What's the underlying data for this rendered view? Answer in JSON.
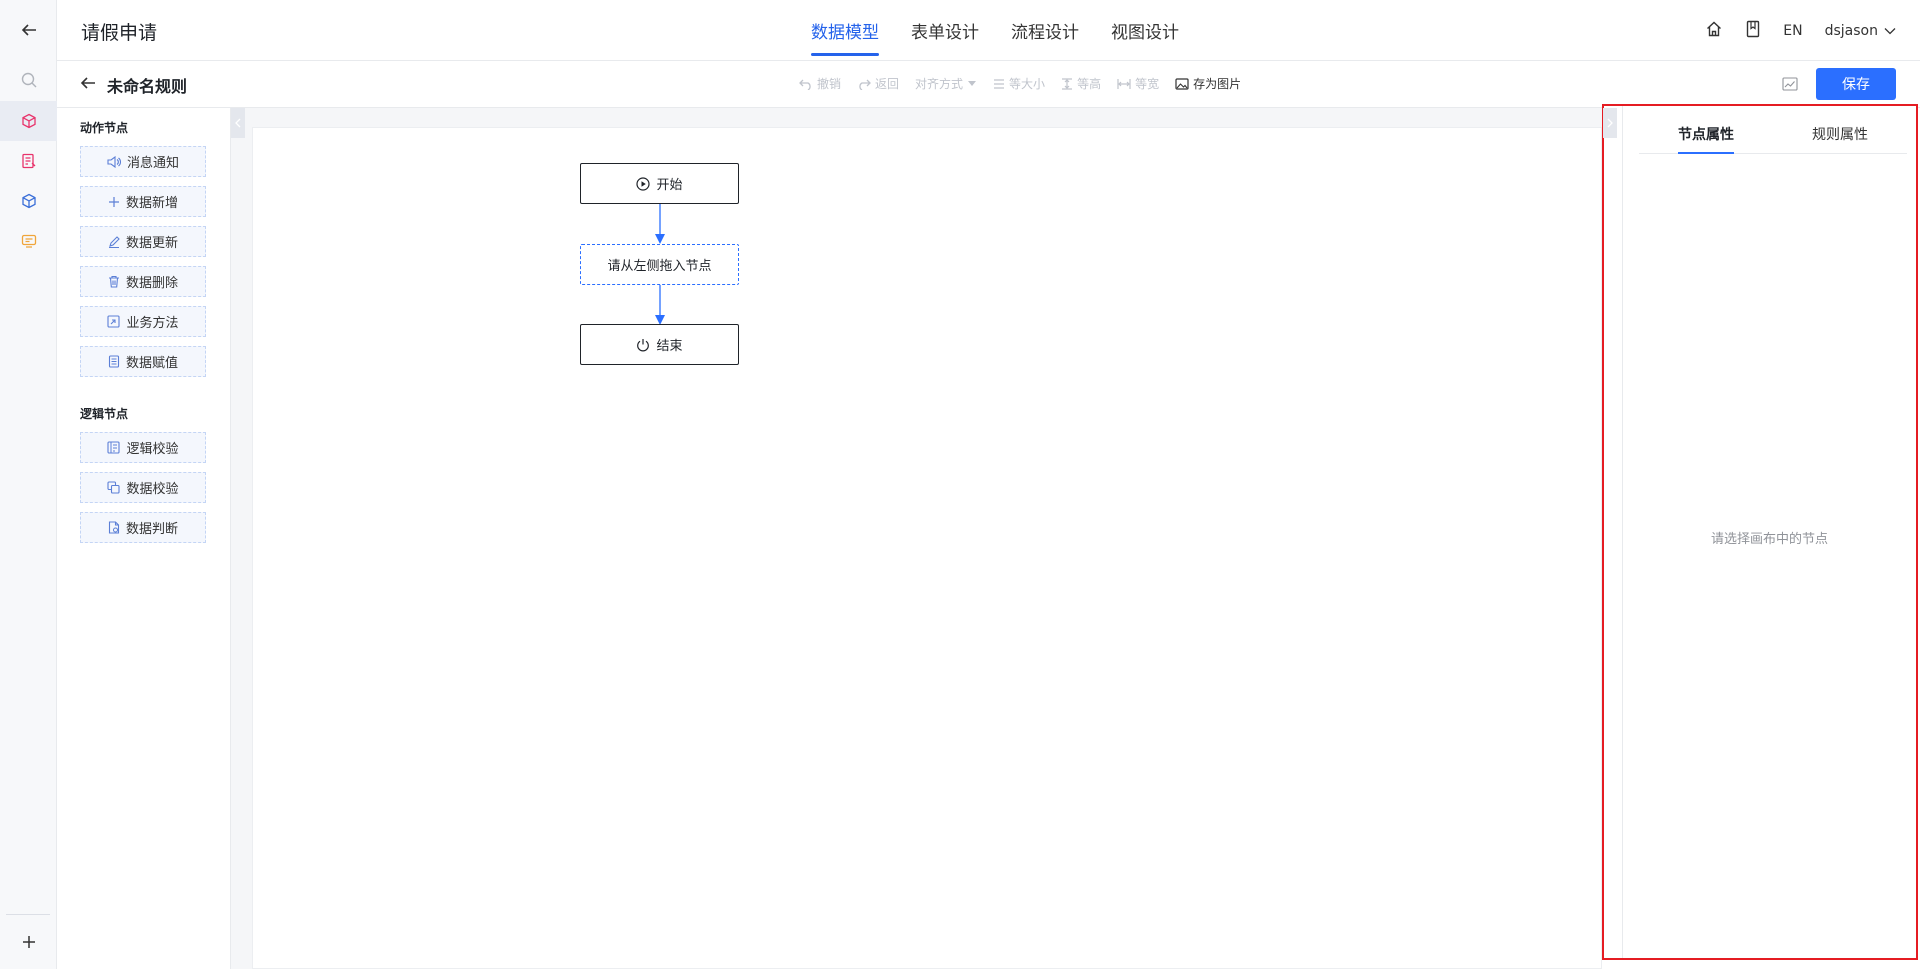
{
  "app": {
    "title": "请假申请"
  },
  "top_tabs": [
    {
      "label": "数据模型",
      "active": true
    },
    {
      "label": "表单设计",
      "active": false
    },
    {
      "label": "流程设计",
      "active": false
    },
    {
      "label": "视图设计",
      "active": false
    }
  ],
  "header_right": {
    "lang": "EN",
    "user": "dsjason"
  },
  "rule": {
    "title": "未命名规则"
  },
  "toolbar": {
    "undo": "撤销",
    "redo": "返回",
    "align": "对齐方式",
    "same_size": "等大小",
    "same_height": "等高",
    "same_width": "等宽",
    "save_image": "存为图片",
    "save": "保存"
  },
  "palette": {
    "action_title": "动作节点",
    "action_items": [
      {
        "label": "消息通知",
        "icon": "speaker-icon"
      },
      {
        "label": "数据新增",
        "icon": "plus-icon"
      },
      {
        "label": "数据更新",
        "icon": "pencil-icon"
      },
      {
        "label": "数据删除",
        "icon": "trash-icon"
      },
      {
        "label": "业务方法",
        "icon": "method-icon"
      },
      {
        "label": "数据赋值",
        "icon": "document-icon"
      }
    ],
    "logic_title": "逻辑节点",
    "logic_items": [
      {
        "label": "逻辑校验",
        "icon": "logic-check-icon"
      },
      {
        "label": "数据校验",
        "icon": "copy-check-icon"
      },
      {
        "label": "数据判断",
        "icon": "file-check-icon"
      }
    ]
  },
  "flow": {
    "start": "开始",
    "placeholder": "请从左侧拖入节点",
    "end": "结束"
  },
  "props_panel": {
    "tabs": [
      {
        "label": "节点属性",
        "active": true
      },
      {
        "label": "规则属性",
        "active": false
      }
    ],
    "empty_hint": "请选择画布中的节点"
  },
  "colors": {
    "accent": "#2b6fff",
    "highlight_border": "#e51c23"
  }
}
